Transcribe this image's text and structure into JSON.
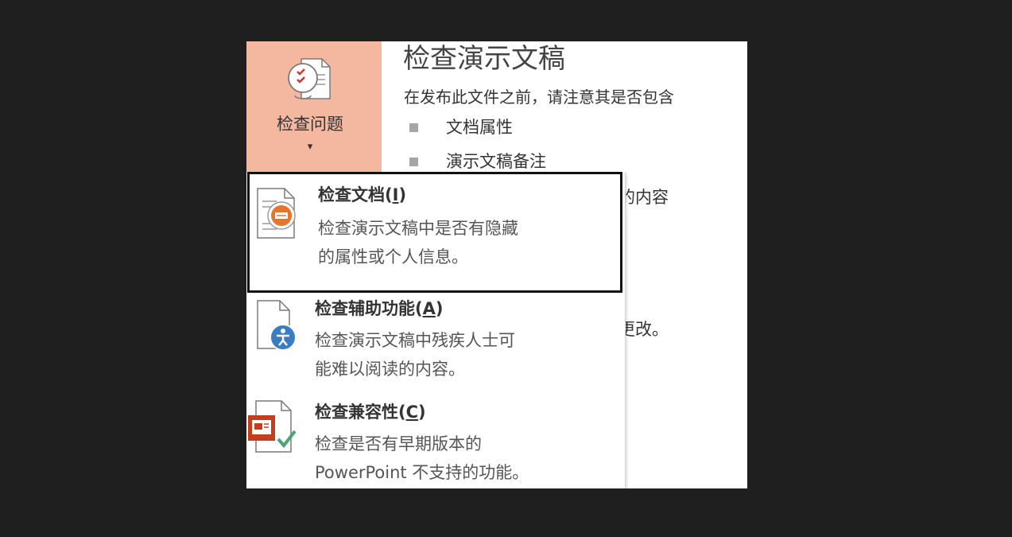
{
  "ribbon": {
    "inspect_label": "检查问题",
    "caret": "▾",
    "inspect_icon": "document-check-icon"
  },
  "panel": {
    "title": "检查演示文稿",
    "description": "在发布此文件之前，请注意其是否包含",
    "list": [
      "文档属性",
      "演示文稿备注"
    ],
    "partial_1": "的内容",
    "partial_2": "更改。"
  },
  "menu": {
    "items": [
      {
        "title_main": "检查文档(",
        "title_key": "I",
        "title_end": ")",
        "description": "检查演示文稿中是否有隐藏\n的属性或个人信息。",
        "icon": "inspect-document-icon",
        "selected": true
      },
      {
        "title_main": "检查辅助功能(",
        "title_key": "A",
        "title_end": ")",
        "description": "检查演示文稿中残疾人士可\n能难以阅读的内容。",
        "icon": "accessibility-checker-icon",
        "selected": false
      },
      {
        "title_main": "检查兼容性(",
        "title_key": "C",
        "title_end": ")",
        "description": "检查是否有早期版本的\nPowerPoint 不支持的功能。",
        "icon": "compatibility-checker-icon",
        "selected": false
      }
    ]
  },
  "colors": {
    "ribbon_highlight": "#f4b8a0",
    "accent_orange": "#e8742a",
    "accent_blue": "#3a7dc4",
    "accent_red": "#c43e1c",
    "check_green": "#4aa574"
  }
}
